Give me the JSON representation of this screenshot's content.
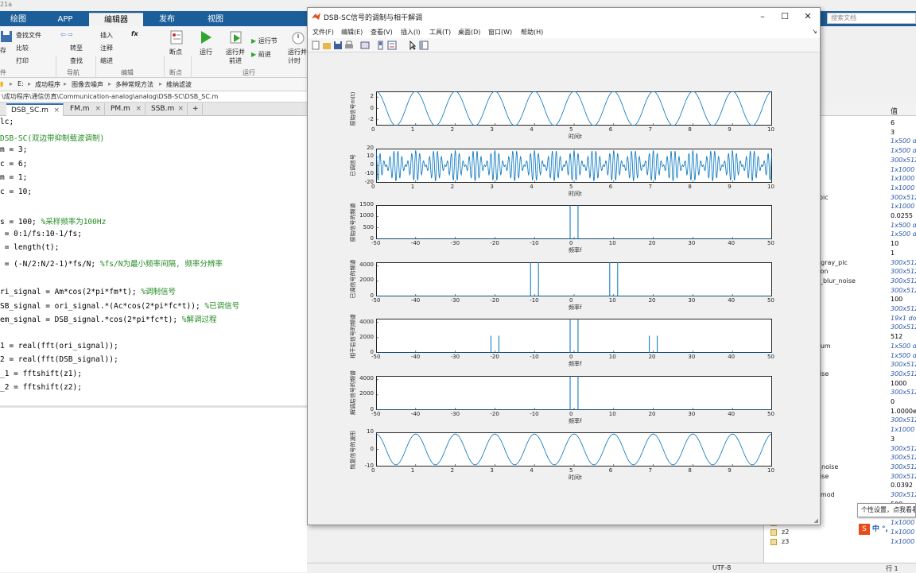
{
  "window": {
    "title_fragment": "21a"
  },
  "main_tabs": [
    {
      "label": "绘图"
    },
    {
      "label": "APP"
    },
    {
      "label": "编辑器"
    },
    {
      "label": "发布"
    },
    {
      "label": "视图"
    }
  ],
  "search": {
    "placeholder": "搜索文档"
  },
  "ribbon": {
    "file": {
      "save": "存",
      "find_files": "查找文件",
      "compare": "比较",
      "print": "打印",
      "group": "件"
    },
    "navigate": {
      "goto": "转至",
      "find": "查找",
      "group": "导航"
    },
    "edit": {
      "insert": "插入",
      "comment": "注释",
      "indent": "缩进",
      "fx": "fx",
      "group": "编辑"
    },
    "breakpoints": {
      "label": "断点",
      "group": "断点"
    },
    "run": {
      "run": "运行",
      "run_advance": "运行并\n前进",
      "run_section": "运行节",
      "advance": "前进",
      "run_time": "运行并\n计时",
      "group": "运行"
    }
  },
  "breadcrumb": [
    "E:",
    "成功程序",
    "图像去噪声",
    "多种常规方法",
    "维纳滤波"
  ],
  "path": "\\成功程序\\通信仿真\\Communication-analog\\analog\\DSB-SC\\DSB_SC.m",
  "file_tabs": [
    {
      "label": "DSB_SC.m"
    },
    {
      "label": "FM.m"
    },
    {
      "label": "PM.m"
    },
    {
      "label": "SSB.m"
    }
  ],
  "code": [
    {
      "t": "lc;",
      "c": ""
    },
    {
      "t": "",
      "c": "DSB-SC(双边带抑制载波调制)"
    },
    {
      "t": "m = 3;",
      "c": ""
    },
    {
      "t": "c = 6;",
      "c": ""
    },
    {
      "t": "m = 1;",
      "c": ""
    },
    {
      "t": "c = 10;",
      "c": ""
    },
    {
      "t": "",
      "c": ""
    },
    {
      "t": "s = 100; ",
      "c": "%采样频率为100Hz"
    },
    {
      "t": " = 0:1/fs:10-1/fs;",
      "c": ""
    },
    {
      "t": " = length(t);",
      "c": ""
    },
    {
      "t": " = (-N/2:N/2-1)*fs/N; ",
      "c": "%fs/N为最小频率间隔, 频率分辨率"
    },
    {
      "t": "",
      "c": ""
    },
    {
      "t": "ri_signal = Am*cos(2*pi*fm*t); ",
      "c": "%调制信号"
    },
    {
      "t": "SB_signal = ori_signal.*(Ac*cos(2*pi*fc*t)); ",
      "c": "%已调信号"
    },
    {
      "t": "em_signal = DSB_signal.*cos(2*pi*fc*t); ",
      "c": "%解调过程"
    },
    {
      "t": "",
      "c": ""
    },
    {
      "t": "1 = real(fft(ori_signal));",
      "c": ""
    },
    {
      "t": "2 = real(fft(DSB_signal));",
      "c": ""
    },
    {
      "t": "_1 = fftshift(z1);",
      "c": ""
    },
    {
      "t": "_2 = fftshift(z2);",
      "c": ""
    }
  ],
  "workspace": {
    "header_value": "值",
    "rows": [
      {
        "name": "",
        "value": "6",
        "blue": false
      },
      {
        "name": "",
        "value": "3",
        "blue": false
      },
      {
        "name": "",
        "value": "1x500 do",
        "blue": true
      },
      {
        "name": "",
        "value": "1x500 do",
        "blue": true
      },
      {
        "name": "",
        "value": "300x512",
        "blue": true
      },
      {
        "name": "",
        "value": "1x1000 d",
        "blue": true
      },
      {
        "name": "um",
        "value": "1x1000 d",
        "blue": true
      },
      {
        "name": "",
        "value": "1x1000 d",
        "blue": true
      },
      {
        "name": "e_pic",
        "value": "300x512",
        "blue": true
      },
      {
        "name": "",
        "value": "1x1000 d",
        "blue": true
      },
      {
        "name": "",
        "value": "0.0255",
        "blue": false
      },
      {
        "name": "",
        "value": "1x500 do",
        "blue": true
      },
      {
        "name": "",
        "value": "1x500 do",
        "blue": true
      },
      {
        "name": "",
        "value": "10",
        "blue": false
      },
      {
        "name": "",
        "value": "1",
        "blue": false
      },
      {
        "name": "le_gray_pic",
        "value": "300x512",
        "blue": true
      },
      {
        "name": "ption",
        "value": "300x512",
        "blue": true
      },
      {
        "name": "on_blur_noise",
        "value": "300x512",
        "blue": true
      },
      {
        "name": "",
        "value": "300x512",
        "blue": true
      },
      {
        "name": "",
        "value": "100",
        "blue": false
      },
      {
        "name": "",
        "value": "300x512",
        "blue": true
      },
      {
        "name": "",
        "value": "19x1 dou",
        "blue": true
      },
      {
        "name": "",
        "value": "300x512",
        "blue": true
      },
      {
        "name": "",
        "value": "512",
        "blue": false
      },
      {
        "name": "ctrum",
        "value": "1x500 do",
        "blue": true
      },
      {
        "name": "",
        "value": "1x500 do",
        "blue": true
      },
      {
        "name": "",
        "value": "300x512",
        "blue": true
      },
      {
        "name": "noise",
        "value": "300x512",
        "blue": true
      },
      {
        "name": "",
        "value": "1000",
        "blue": false
      },
      {
        "name": "",
        "value": "300x512",
        "blue": true
      },
      {
        "name": "",
        "value": "0",
        "blue": false
      },
      {
        "name": "",
        "value": "1.0000e-",
        "blue": false
      },
      {
        "name": "",
        "value": "300x512",
        "blue": true
      },
      {
        "name": "",
        "value": "1x1000 d",
        "blue": true
      },
      {
        "name": "",
        "value": "3",
        "blue": false
      },
      {
        "name": "on",
        "value": "300x512",
        "blue": true
      },
      {
        "name": "",
        "value": "300x512",
        "blue": true
      },
      {
        "name": "re_noise",
        "value": "300x512",
        "blue": true
      },
      {
        "name": "noise",
        "value": "300x512",
        "blue": true
      },
      {
        "name": "",
        "value": "0.0392",
        "blue": false
      },
      {
        "name": "M_mod",
        "value": "300x512",
        "blue": true
      },
      {
        "name": "",
        "value": "500",
        "blue": false
      },
      {
        "name": "z",
        "value": "",
        "blue": false
      },
      {
        "name": "z1",
        "value": "1x1000 d",
        "blue": true
      },
      {
        "name": "z2",
        "value": "1x1000 d",
        "blue": true
      },
      {
        "name": "z3",
        "value": "1x1000 d",
        "blue": true
      }
    ]
  },
  "tooltip": "个性设置，点我看看",
  "ime": "中 °,",
  "status": {
    "encoding": "UTF-8",
    "line": "行 1"
  },
  "figure": {
    "title": "DSB-SC信号的调制与相干解调",
    "menu": [
      "文件(F)",
      "编辑(E)",
      "查看(V)",
      "插入(I)",
      "工具(T)",
      "桌面(D)",
      "窗口(W)",
      "帮助(H)"
    ],
    "line_color": "#0072bd"
  },
  "chart_data": [
    {
      "type": "line",
      "ylabel": "原始信号m(t)",
      "xlabel": "时间t",
      "xlim": [
        0,
        10
      ],
      "ylim": [
        -3,
        3
      ],
      "xticks": [
        0,
        1,
        2,
        3,
        4,
        5,
        6,
        7,
        8,
        9,
        10
      ],
      "yticks": [
        -2,
        0,
        2
      ],
      "signal": "Am*cos(2*pi*fm*t)",
      "params": {
        "Am": 3,
        "fm": 1
      }
    },
    {
      "type": "line",
      "ylabel": "已调信号",
      "xlabel": "时间t",
      "xlim": [
        0,
        10
      ],
      "ylim": [
        -20,
        20
      ],
      "xticks": [
        0,
        1,
        2,
        3,
        4,
        5,
        6,
        7,
        8,
        9,
        10
      ],
      "yticks": [
        -20,
        -10,
        0,
        10,
        20
      ],
      "signal": "Am*cos(2*pi*fm*t)*Ac*cos(2*pi*fc*t)",
      "params": {
        "Am": 3,
        "Ac": 6,
        "fm": 1,
        "fc": 10
      }
    },
    {
      "type": "stem",
      "ylabel": "原始信号的频谱",
      "xlabel": "频率f",
      "xlim": [
        -50,
        50
      ],
      "ylim": [
        0,
        1500
      ],
      "xticks": [
        -50,
        -40,
        -30,
        -20,
        -10,
        0,
        10,
        20,
        30,
        40,
        50
      ],
      "yticks": [
        0,
        500,
        1000,
        1500
      ],
      "peaks": [
        {
          "f": -1,
          "a": 1500
        },
        {
          "f": 1,
          "a": 1500
        }
      ]
    },
    {
      "type": "stem",
      "ylabel": "已调信号的频谱",
      "xlabel": "频率f",
      "xlim": [
        -50,
        50
      ],
      "ylim": [
        0,
        4500
      ],
      "xticks": [
        -50,
        -40,
        -30,
        -20,
        -10,
        0,
        10,
        20,
        30,
        40,
        50
      ],
      "yticks": [
        0,
        2000,
        4000
      ],
      "peaks": [
        {
          "f": -11,
          "a": 4500
        },
        {
          "f": -9,
          "a": 4500
        },
        {
          "f": 9,
          "a": 4500
        },
        {
          "f": 11,
          "a": 4500
        }
      ]
    },
    {
      "type": "stem",
      "ylabel": "相干后信号的频谱",
      "xlabel": "频率f",
      "xlim": [
        -50,
        50
      ],
      "ylim": [
        0,
        4500
      ],
      "xticks": [
        -50,
        -40,
        -30,
        -20,
        -10,
        0,
        10,
        20,
        30,
        40,
        50
      ],
      "yticks": [
        0,
        2000,
        4000
      ],
      "peaks": [
        {
          "f": -21,
          "a": 2250
        },
        {
          "f": -19,
          "a": 2250
        },
        {
          "f": -1,
          "a": 4500
        },
        {
          "f": 1,
          "a": 4500
        },
        {
          "f": 19,
          "a": 2250
        },
        {
          "f": 21,
          "a": 2250
        }
      ]
    },
    {
      "type": "stem",
      "ylabel": "解调后信号的频谱",
      "xlabel": "频率f",
      "xlim": [
        -50,
        50
      ],
      "ylim": [
        0,
        4500
      ],
      "xticks": [
        -50,
        -40,
        -30,
        -20,
        -10,
        0,
        10,
        20,
        30,
        40,
        50
      ],
      "yticks": [
        0,
        2000,
        4000
      ],
      "peaks": [
        {
          "f": -1,
          "a": 4500
        },
        {
          "f": 1,
          "a": 4500
        }
      ]
    },
    {
      "type": "line",
      "ylabel": "恢复信号的波形",
      "xlabel": "时间t",
      "xlim": [
        0,
        10
      ],
      "ylim": [
        -10,
        10
      ],
      "xticks": [
        0,
        1,
        2,
        3,
        4,
        5,
        6,
        7,
        8,
        9,
        10
      ],
      "yticks": [
        -10,
        0,
        10
      ],
      "signal": "9*cos(2*pi*fm*t)",
      "params": {
        "amplitude": 9,
        "fm": 1
      }
    }
  ]
}
